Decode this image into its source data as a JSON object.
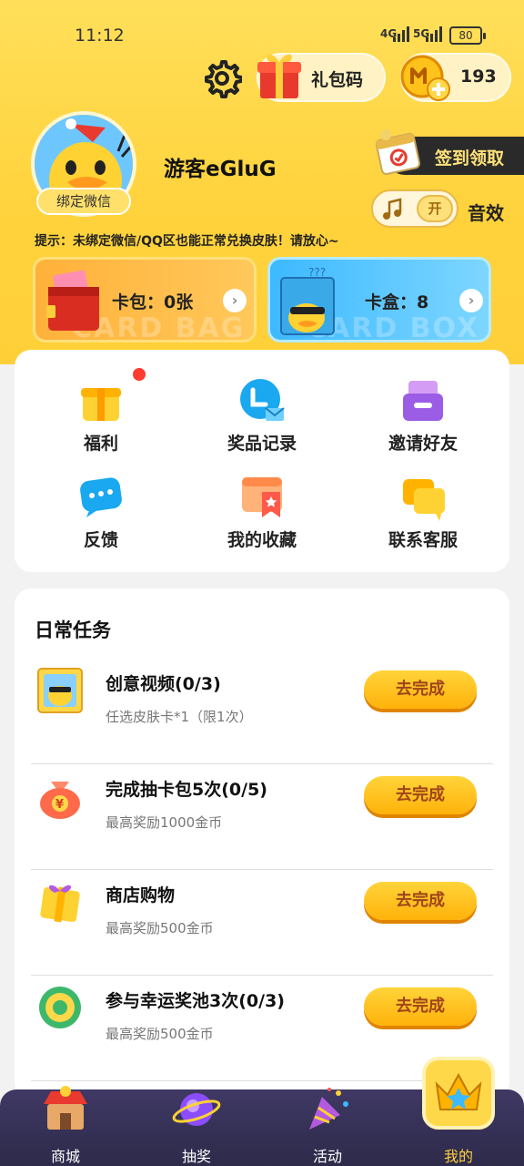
{
  "status_bar": {
    "time": "11:12",
    "net1": "4G",
    "net2": "5G",
    "battery": "80"
  },
  "header": {
    "gift_code_label": "礼包码",
    "coin_count": "193",
    "username": "游客eGluG",
    "bind_wechat_label": "绑定微信",
    "checkin_label": "签到领取",
    "sound_toggle_state": "开",
    "sound_label": "音效",
    "hint": "提示：未绑定微信/QQ区也能正常兑换皮肤！请放心~"
  },
  "cards": {
    "bag": {
      "label": "卡包：0张",
      "watermark": "CARD BAG"
    },
    "box": {
      "label": "卡盒：8",
      "watermark": "CARD BOX"
    }
  },
  "menu": {
    "items": [
      {
        "label": "福利",
        "icon": "gift-icon",
        "badge": true
      },
      {
        "label": "奖品记录",
        "icon": "prize-record-icon"
      },
      {
        "label": "邀请好友",
        "icon": "invite-icon"
      },
      {
        "label": "反馈",
        "icon": "feedback-icon"
      },
      {
        "label": "我的收藏",
        "icon": "favorites-icon"
      },
      {
        "label": "联系客服",
        "icon": "customer-service-icon"
      }
    ]
  },
  "tasks": {
    "title": "日常任务",
    "button_label": "去完成",
    "items": [
      {
        "title": "创意视频(0/3)",
        "sub": "任选皮肤卡*1（限1次）",
        "icon": "video-card-icon"
      },
      {
        "title": "完成抽卡包5次(0/5)",
        "sub": "最高奖励1000金币",
        "icon": "money-bag-icon"
      },
      {
        "title": "商店购物",
        "sub": "最高奖励500金币",
        "icon": "shopping-gift-icon"
      },
      {
        "title": "参与幸运奖池3次(0/3)",
        "sub": "最高奖励500金币",
        "icon": "lucky-pool-icon"
      }
    ]
  },
  "tabbar": {
    "items": [
      {
        "label": "商城",
        "icon": "shop-icon"
      },
      {
        "label": "抽奖",
        "icon": "lottery-planet-icon"
      },
      {
        "label": "活动",
        "icon": "party-popper-icon"
      },
      {
        "label": "我的",
        "icon": "crown-icon",
        "active": true
      }
    ]
  },
  "colors": {
    "accent": "#ffd33d",
    "tab_active": "#ffcf3b",
    "tabbar_bg": "#2d2a4a"
  }
}
